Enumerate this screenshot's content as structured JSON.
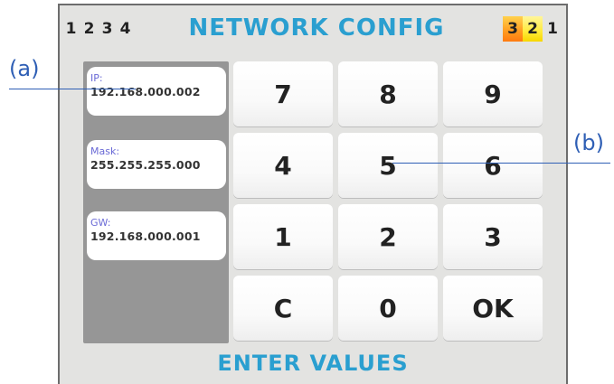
{
  "header": {
    "title": "NETWORK CONFIG",
    "left_tabs": [
      "1",
      "2",
      "3",
      "4"
    ],
    "right_tabs": [
      "3",
      "2",
      "1"
    ]
  },
  "fields": [
    {
      "label": "IP:",
      "value": "192.168.000.002"
    },
    {
      "label": "Mask:",
      "value": "255.255.255.000"
    },
    {
      "label": "GW:",
      "value": "192.168.000.001"
    }
  ],
  "keypad": [
    "7",
    "8",
    "9",
    "4",
    "5",
    "6",
    "1",
    "2",
    "3",
    "C",
    "0",
    "OK"
  ],
  "footer": {
    "text": "ENTER VALUES"
  },
  "callouts": {
    "a": "(a)",
    "b": "(b)"
  },
  "colors": {
    "accent": "#2a9fd0",
    "label": "#6a6ad6",
    "callout": "#2f5fb5",
    "badge_orange": "#ff9a1f",
    "badge_yellow": "#ffeb3b"
  }
}
